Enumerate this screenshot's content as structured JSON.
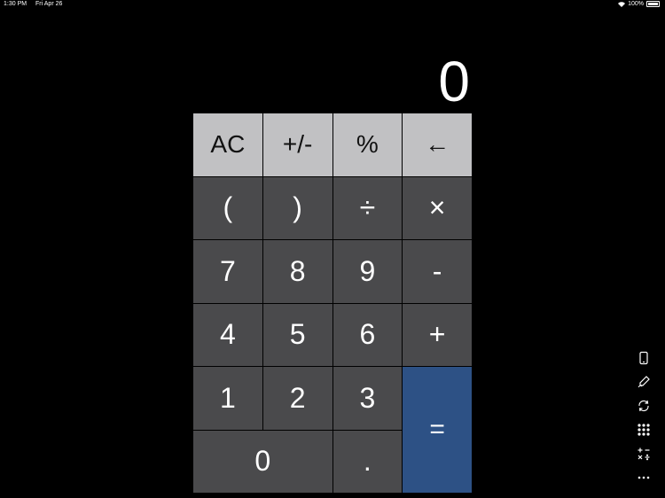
{
  "status_bar": {
    "time": "1:30 PM",
    "date": "Fri Apr 26",
    "battery": "100%"
  },
  "display": {
    "value": "0"
  },
  "keys": {
    "ac": "AC",
    "plus_minus": "+/-",
    "percent": "%",
    "backspace": "←",
    "open_paren": "(",
    "close_paren": ")",
    "divide": "÷",
    "multiply": "×",
    "seven": "7",
    "eight": "8",
    "nine": "9",
    "minus": "-",
    "four": "4",
    "five": "5",
    "six": "6",
    "plus": "+",
    "one": "1",
    "two": "2",
    "three": "3",
    "equals": "=",
    "zero": "0",
    "dot": "."
  },
  "icons": [
    "phone-icon",
    "pen-icon",
    "rotate-icon",
    "keypad-grid-icon",
    "operators-icon",
    "more-icon"
  ],
  "colors": {
    "light_key": "#c1c1c3",
    "dark_key": "#4a4a4c",
    "equals_key": "#2d5185",
    "background": "#000000"
  }
}
